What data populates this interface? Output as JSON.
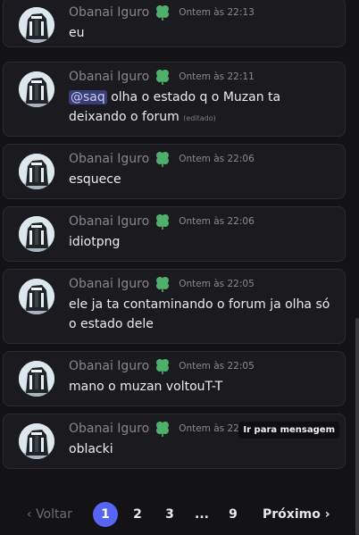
{
  "messages": [
    {
      "author": "Obanai Iguro",
      "timestamp": "Ontem às 22:13",
      "text": "eu"
    },
    {
      "author": "Obanai Iguro",
      "timestamp": "Ontem às 22:11",
      "mention": "@saq",
      "text": " olha o estado q o Muzan ta deixando o forum",
      "edited": "(editado)"
    },
    {
      "author": "Obanai Iguro",
      "timestamp": "Ontem às 22:06",
      "text": "esquece"
    },
    {
      "author": "Obanai Iguro",
      "timestamp": "Ontem às 22:06",
      "text": "idiotpng"
    },
    {
      "author": "Obanai Iguro",
      "timestamp": "Ontem às 22:05",
      "text": "ele ja ta contaminando o forum ja olha só o estado dele"
    },
    {
      "author": "Obanai Iguro",
      "timestamp": "Ontem às 22:05",
      "text": "mano o muzan voltouT-T"
    },
    {
      "author": "Obanai Iguro",
      "timestamp": "Ontem às 22:05",
      "text": "oblacki",
      "jump_tooltip": "Ir para mensagem"
    }
  ],
  "pagination": {
    "prev": "Voltar",
    "pages": [
      "1",
      "2",
      "3",
      "...",
      "9"
    ],
    "current": "1",
    "next": "Próximo"
  },
  "colors": {
    "accent": "#5865f2",
    "role_icon": "#4fb06b",
    "mention_bg": "#3a3d73"
  }
}
